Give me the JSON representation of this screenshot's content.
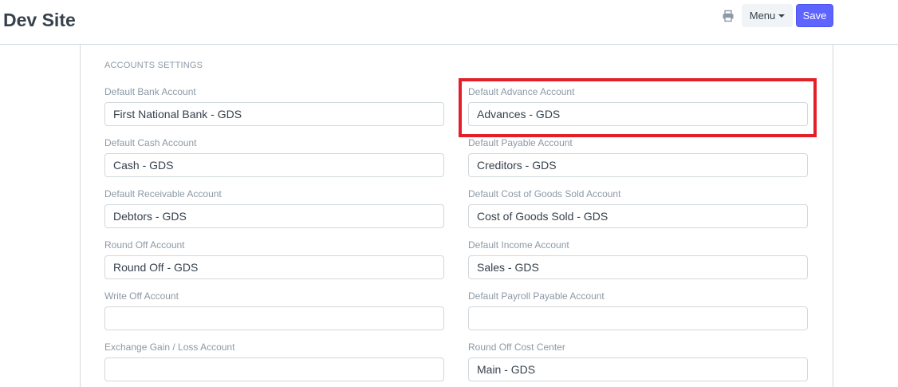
{
  "header": {
    "title": "Dev Site",
    "menu_label": "Menu",
    "save_label": "Save"
  },
  "section": {
    "title": "ACCOUNTS SETTINGS"
  },
  "left_fields": [
    {
      "label": "Default Bank Account",
      "value": "First National Bank - GDS"
    },
    {
      "label": "Default Cash Account",
      "value": "Cash - GDS"
    },
    {
      "label": "Default Receivable Account",
      "value": "Debtors - GDS"
    },
    {
      "label": "Round Off Account",
      "value": "Round Off - GDS"
    },
    {
      "label": "Write Off Account",
      "value": ""
    },
    {
      "label": "Exchange Gain / Loss Account",
      "value": ""
    }
  ],
  "right_fields": [
    {
      "label": "Default Advance Account",
      "value": "Advances - GDS"
    },
    {
      "label": "Default Payable Account",
      "value": "Creditors - GDS"
    },
    {
      "label": "Default Cost of Goods Sold Account",
      "value": "Cost of Goods Sold - GDS"
    },
    {
      "label": "Default Income Account",
      "value": "Sales - GDS"
    },
    {
      "label": "Default Payroll Payable Account",
      "value": ""
    },
    {
      "label": "Round Off Cost Center",
      "value": "Main - GDS"
    }
  ],
  "colors": {
    "primary": "#5e64ff",
    "highlight": "#e3202a",
    "label": "#8d99a6",
    "text": "#36414c"
  },
  "icons": {
    "print": "print-icon",
    "menu_caret": "caret-down-icon"
  }
}
